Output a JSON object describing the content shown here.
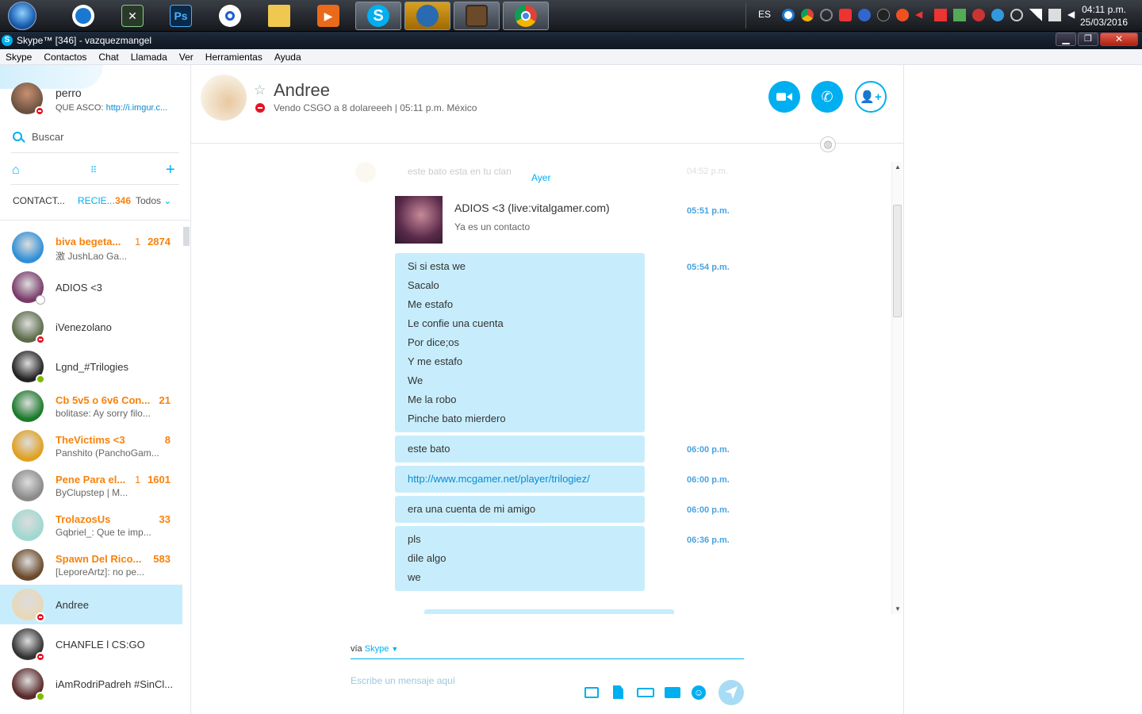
{
  "taskbar": {
    "lang": "ES",
    "time": "04:11 p.m.",
    "date": "25/03/2016",
    "apps": [
      {
        "icon": "start-orb-icon"
      },
      {
        "icon": "app-blue-icon"
      },
      {
        "icon": "app-green-icon"
      },
      {
        "icon": "photoshop-icon",
        "label": "Ps"
      },
      {
        "icon": "app-target-icon"
      },
      {
        "icon": "folder-icon"
      },
      {
        "icon": "media-player-icon"
      },
      {
        "icon": "skype-icon",
        "label": "S"
      },
      {
        "icon": "app-orange-icon"
      },
      {
        "icon": "minecraft-icon"
      },
      {
        "icon": "chrome-icon"
      }
    ]
  },
  "window": {
    "title": "Skype™ [346] - vazquezmangel",
    "menu": [
      "Skype",
      "Contactos",
      "Chat",
      "Llamada",
      "Ver",
      "Herramientas",
      "Ayuda"
    ]
  },
  "profile": {
    "name": "perro",
    "mood_prefix": "QUE ASCO: ",
    "mood_link": "http://i.imgur.c..."
  },
  "search": {
    "placeholder": "Buscar"
  },
  "tabs": {
    "contacts": "CONTACT...",
    "recent": "RECIE...",
    "count": "346",
    "filter": "Todos"
  },
  "contacts": [
    {
      "name": "biva begeta...",
      "sub": "激 JushLao Ga...",
      "badge": "1",
      "count": "2874",
      "unread": true,
      "status": "none",
      "color": "#2f8fd6"
    },
    {
      "name": "ADIOS <3",
      "sub": "",
      "badge": "",
      "count": "",
      "unread": false,
      "status": "grey",
      "color": "#7a3a6a"
    },
    {
      "name": "iVenezolano",
      "sub": "",
      "badge": "",
      "count": "",
      "unread": false,
      "status": "red",
      "color": "#5c6c4a"
    },
    {
      "name": "Lgnd_#Trilogies",
      "sub": "",
      "badge": "",
      "count": "",
      "unread": false,
      "status": "green",
      "color": "#222222"
    },
    {
      "name": "Cb 5v5 o 6v6 Con...",
      "sub": "bolitase: Ay sorry filo...",
      "badge": "",
      "count": "21",
      "unread": true,
      "status": "none",
      "color": "#1a7a2a"
    },
    {
      "name": "TheVictims <3",
      "sub": "Panshito (PanchoGam...",
      "badge": "",
      "count": "8",
      "unread": true,
      "status": "none",
      "color": "#e0a020"
    },
    {
      "name": "Pene Para el...",
      "sub": "ByClupstep | M...",
      "badge": "1",
      "count": "1601",
      "unread": true,
      "status": "none",
      "color": "#8a8a8a"
    },
    {
      "name": "TrolazosUs",
      "sub": "Gqbriel_: Que te imp...",
      "badge": "",
      "count": "33",
      "unread": true,
      "status": "none",
      "color": "#9fd8d0"
    },
    {
      "name": "Spawn Del Rico...",
      "sub": "[LeporeArtz]: no pe...",
      "badge": "",
      "count": "583",
      "unread": true,
      "status": "none",
      "color": "#6a4a2a"
    },
    {
      "name": "Andree",
      "sub": "",
      "badge": "",
      "count": "",
      "unread": false,
      "status": "red",
      "color": "#e8d8b8",
      "selected": true
    },
    {
      "name": "CHANFLE l CS:GO",
      "sub": "",
      "badge": "",
      "count": "",
      "unread": false,
      "status": "red",
      "color": "#333333"
    },
    {
      "name": "iAmRodriPadreh #SinCl...",
      "sub": "",
      "badge": "",
      "count": "",
      "unread": false,
      "status": "green",
      "color": "#5a2a2a"
    }
  ],
  "chat": {
    "name": "Andree",
    "mood": "Vendo CSGO a 8 dolareeeh",
    "time_sep": "|",
    "local_time": "05:11 p.m. México",
    "faded_prev_message": "este bato esta en tu clan",
    "faded_prev_time": "04:52 p.m.",
    "day_label": "Ayer",
    "contact_card": {
      "title": "ADIOS <3 (live:vitalgamer.com)",
      "subtitle": "Ya es un contacto",
      "time": "05:51 p.m."
    },
    "messages": [
      {
        "lines": [
          "Si si esta we",
          "Sacalo",
          "Me estafo",
          "Le confie una cuenta",
          "Por dice;os",
          "Y me estafo",
          "We",
          "Me la robo",
          "Pinche bato mierdero"
        ],
        "time": "05:54 p.m."
      },
      {
        "lines": [
          "este bato"
        ],
        "time": "06:00 p.m."
      },
      {
        "lines": [
          "http://www.mcgamer.net/player/trilogiez/"
        ],
        "time": "06:00 p.m.",
        "link": true
      },
      {
        "lines": [
          "era una cuenta de mi amigo"
        ],
        "time": "06:00 p.m."
      },
      {
        "lines": [
          "pls",
          "dile algo",
          "we"
        ],
        "time": "06:36 p.m."
      }
    ],
    "via_label": "vía",
    "via_service": "Skype",
    "input_placeholder": "Escribe un mensaje aquí"
  },
  "colors": {
    "skype_blue": "#00aff0",
    "bubble": "#c7edfc",
    "unread_orange": "#f8820c",
    "selected_row": "#c7edfc"
  }
}
